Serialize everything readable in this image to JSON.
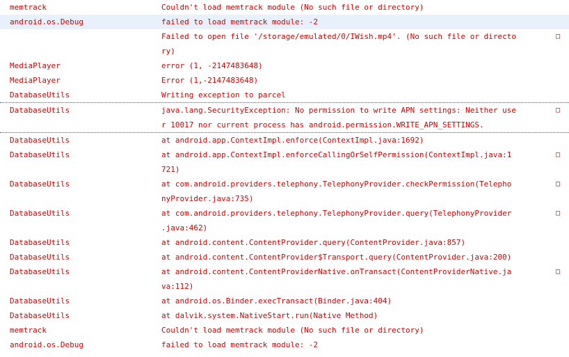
{
  "rows": [
    {
      "tag": "memtrack",
      "lines": [
        "Couldn't load memtrack module (No such file or directory)"
      ]
    },
    {
      "tag": "android.os.Debug",
      "lines": [
        "failed to load memtrack module: -2"
      ],
      "selected": true
    },
    {
      "tag": "",
      "lines": [
        "Failed to open file '/storage/emulated/0/IWish.mp4'. (No such file or directo",
        "ry)"
      ]
    },
    {
      "tag": "MediaPlayer",
      "lines": [
        "error (1, -2147483648)"
      ]
    },
    {
      "tag": "MediaPlayer",
      "lines": [
        "Error (1,-2147483648)"
      ]
    },
    {
      "tag": "DatabaseUtils",
      "lines": [
        "Writing exception to parcel"
      ]
    },
    {
      "tag": "DatabaseUtils",
      "lines": [
        "java.lang.SecurityException: No permission to write APN settings: Neither use",
        "r 10017 nor current process has android.permission.WRITE_APN_SETTINGS."
      ],
      "focused": true
    },
    {
      "tag": "DatabaseUtils",
      "lines": [
        "at android.app.ContextImpl.enforce(ContextImpl.java:1692)"
      ]
    },
    {
      "tag": "DatabaseUtils",
      "lines": [
        "at android.app.ContextImpl.enforceCallingOrSelfPermission(ContextImpl.java:1",
        "721)"
      ]
    },
    {
      "tag": "DatabaseUtils",
      "lines": [
        "at com.android.providers.telephony.TelephonyProvider.checkPermission(Telepho",
        "nyProvider.java:735)"
      ]
    },
    {
      "tag": "DatabaseUtils",
      "lines": [
        "at com.android.providers.telephony.TelephonyProvider.query(TelephonyProvider",
        ".java:462)"
      ]
    },
    {
      "tag": "DatabaseUtils",
      "lines": [
        "at android.content.ContentProvider.query(ContentProvider.java:857)"
      ]
    },
    {
      "tag": "DatabaseUtils",
      "lines": [
        "at android.content.ContentProvider$Transport.query(ContentProvider.java:200)"
      ]
    },
    {
      "tag": "DatabaseUtils",
      "lines": [
        "at android.content.ContentProviderNative.onTransact(ContentProviderNative.ja",
        "va:112)"
      ]
    },
    {
      "tag": "DatabaseUtils",
      "lines": [
        "at android.os.Binder.execTransact(Binder.java:404)"
      ]
    },
    {
      "tag": "DatabaseUtils",
      "lines": [
        "at dalvik.system.NativeStart.run(Native Method)"
      ]
    },
    {
      "tag": "memtrack",
      "lines": [
        "Couldn't load memtrack module (No such file or directory)"
      ]
    },
    {
      "tag": "android.os.Debug",
      "lines": [
        "failed to load memtrack module: -2"
      ]
    }
  ],
  "wrap_glyph": "□",
  "colors": {
    "text": "#d00000",
    "selected_row_background": "#e8f0fc",
    "focus_border": "#555555"
  }
}
